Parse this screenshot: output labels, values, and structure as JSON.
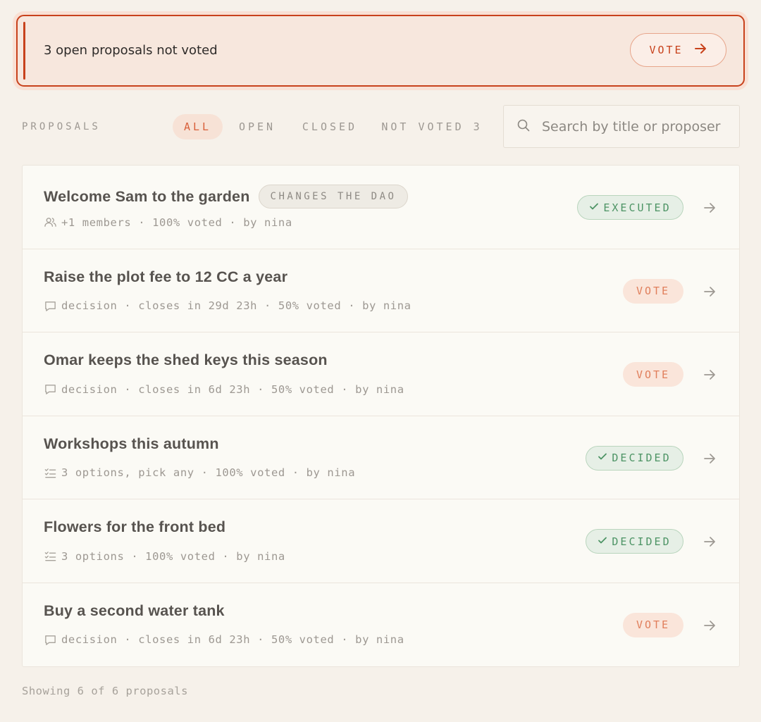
{
  "alert": {
    "message": "3 open proposals not voted",
    "button_label": "VOTE",
    "accent_color": "#c8421c"
  },
  "filters": {
    "section_label": "PROPOSALS",
    "tabs": [
      {
        "label": "ALL",
        "active": true
      },
      {
        "label": "OPEN",
        "active": false
      },
      {
        "label": "CLOSED",
        "active": false
      },
      {
        "label": "NOT VOTED 3",
        "active": false
      }
    ],
    "search_placeholder": "Search by title or proposer"
  },
  "proposals": [
    {
      "title": "Welcome Sam to the garden",
      "tag": "CHANGES THE DAO",
      "meta_icon": "members-icon",
      "meta": "+1 members · 100% voted · by nina",
      "status": "EXECUTED",
      "status_kind": "ok"
    },
    {
      "title": "Raise the plot fee to 12 CC a year",
      "meta_icon": "comment-icon",
      "meta": "decision · closes in 29d 23h · 50% voted · by nina",
      "status": "VOTE",
      "status_kind": "vote"
    },
    {
      "title": "Omar keeps the shed keys this season",
      "meta_icon": "comment-icon",
      "meta": "decision · closes in 6d 23h · 50% voted · by nina",
      "status": "VOTE",
      "status_kind": "vote"
    },
    {
      "title": "Workshops this autumn",
      "meta_icon": "checklist-icon",
      "meta": "3 options, pick any · 100% voted · by nina",
      "status": "DECIDED",
      "status_kind": "ok"
    },
    {
      "title": "Flowers for the front bed",
      "meta_icon": "checklist-icon",
      "meta": "3 options · 100% voted · by nina",
      "status": "DECIDED",
      "status_kind": "ok"
    },
    {
      "title": "Buy a second water tank",
      "meta_icon": "comment-icon",
      "meta": "decision · closes in 6d 23h · 50% voted · by nina",
      "status": "VOTE",
      "status_kind": "vote"
    }
  ],
  "footer": {
    "count_text": "Showing 6 of 6 proposals"
  },
  "colors": {
    "background": "#f6f1ea",
    "vote_badge": "#e07f5c",
    "ok_badge": "#4d9465"
  }
}
